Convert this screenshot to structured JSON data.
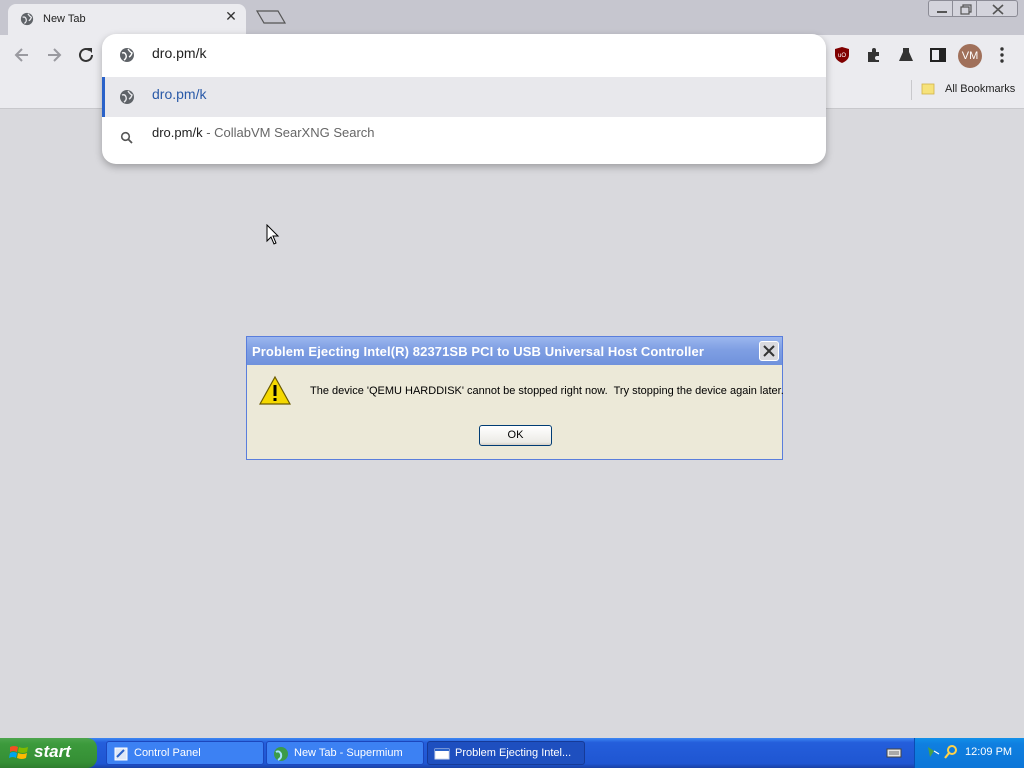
{
  "browser": {
    "tab": {
      "title": "New Tab"
    },
    "omnibox": {
      "input_value": "dro.pm/k",
      "suggestions": [
        {
          "text": "dro.pm/k",
          "icon": "globe-icon"
        },
        {
          "text": "dro.pm/k",
          "suffix": " - CollabVM SearXNG Search",
          "icon": "search-icon"
        }
      ]
    },
    "avatar_initials": "VM",
    "bookmarks": {
      "all_bookmarks_label": "All Bookmarks"
    }
  },
  "dialog": {
    "title": "Problem Ejecting Intel(R) 82371SB PCI to USB Universal Host Controller",
    "message": "The device 'QEMU HARDDISK' cannot be stopped right now.  Try stopping the device again later.",
    "ok_label": "OK"
  },
  "taskbar": {
    "start_label": "start",
    "tasks": [
      {
        "label": "Control Panel"
      },
      {
        "label": "New Tab - Supermium"
      },
      {
        "label": "Problem Ejecting Intel..."
      }
    ],
    "clock": "12:09 PM"
  },
  "colors": {
    "accent": "#2a62c9",
    "taskbar": "#245edb",
    "start": "#3c9a3c",
    "dialog_bg": "#ece9d8"
  }
}
